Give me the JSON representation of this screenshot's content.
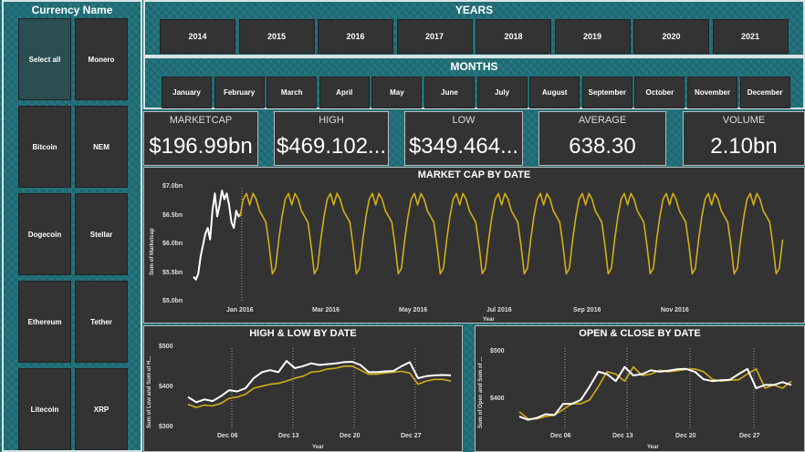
{
  "currency": {
    "title": "Currency Name",
    "items": [
      "Select all",
      "Monero",
      "Bitcoin",
      "NEM",
      "Dogecoin",
      "Stellar",
      "Ethereum",
      "Tether",
      "Litecoin",
      "XRP"
    ]
  },
  "years": {
    "title": "YEARS",
    "items": [
      "2014",
      "2015",
      "2016",
      "2017",
      "2018",
      "2019",
      "2020",
      "2021"
    ]
  },
  "months": {
    "title": "MONTHS",
    "items": [
      "January",
      "February",
      "March",
      "April",
      "May",
      "June",
      "July",
      "August",
      "September",
      "October",
      "November",
      "December"
    ]
  },
  "kpis": [
    {
      "label": "MARKETCAP",
      "value": "$196.99bn"
    },
    {
      "label": "HIGH",
      "value": "$469.102..."
    },
    {
      "label": "LOW",
      "value": "$349.464..."
    },
    {
      "label": "AVERAGE",
      "value": "638.30"
    },
    {
      "label": "VOLUME",
      "value": "2.10bn"
    }
  ],
  "colors": {
    "accent": "#d4ad17",
    "line": "#ffffff",
    "bg": "#333333",
    "teal": "#1f6f78"
  },
  "chart_data": [
    {
      "type": "line",
      "title": "MARKET CAP BY DATE",
      "xlabel": "Year",
      "ylabel": "Sum of Marketcap",
      "yticks": [
        "$7.0bn",
        "$6.5bn",
        "$6.0bn",
        "$5.5bn",
        "$5.0bn"
      ],
      "xticks": [
        "Jan 2016",
        "Mar 2016",
        "May 2016",
        "Jul 2016",
        "Sep 2016",
        "Nov 2016"
      ],
      "ylim": [
        5.0,
        7.0
      ],
      "series": [
        {
          "values": [
            5.45,
            5.4,
            5.5,
            5.8,
            6.0,
            6.2,
            6.3,
            6.1,
            6.6,
            6.9,
            6.5,
            6.7,
            6.95,
            6.8,
            6.9,
            6.7,
            6.4,
            6.3,
            6.6,
            6.5,
            6.55
          ]
        },
        {
          "values": [
            6.5,
            6.8,
            6.9,
            6.7,
            6.9,
            6.8,
            6.6,
            6.5,
            6.4,
            6.0,
            5.5,
            5.6,
            6.1
          ]
        }
      ]
    },
    {
      "type": "line",
      "title": "HIGH & LOW BY DATE",
      "xlabel": "Year",
      "ylabel": "Sum of Low and Sum of H...",
      "yticks": [
        "$500",
        "$400",
        "$300"
      ],
      "xticks": [
        "Dec 06",
        "Dec 13",
        "Dec 20",
        "Dec 27"
      ],
      "ylim": [
        300,
        500
      ],
      "series": [
        {
          "values": [
            378,
            365,
            372,
            368,
            380,
            395,
            392,
            400,
            425,
            440,
            445,
            440,
            468,
            450,
            455,
            462,
            458,
            460,
            462,
            465,
            466,
            458,
            440,
            440,
            442,
            443,
            455,
            465,
            425,
            430,
            432,
            433,
            432
          ]
        },
        {
          "values": [
            360,
            352,
            358,
            356,
            362,
            375,
            378,
            385,
            400,
            405,
            410,
            412,
            418,
            425,
            430,
            440,
            442,
            448,
            450,
            455,
            455,
            445,
            435,
            435,
            438,
            440,
            442,
            438,
            410,
            418,
            422,
            422,
            418
          ]
        }
      ]
    },
    {
      "type": "line",
      "title": "OPEN & CLOSE BY DATE",
      "xlabel": "Year",
      "ylabel": "Sum of Open and Sum of ...",
      "yticks": [
        "$500",
        "$400"
      ],
      "xticks": [
        "Dec 06",
        "Dec 13",
        "Dec 20",
        "Dec 27"
      ],
      "ylim": [
        340,
        510
      ],
      "series": [
        {
          "values": [
            365,
            358,
            362,
            370,
            368,
            392,
            392,
            400,
            428,
            460,
            455,
            440,
            470,
            452,
            455,
            463,
            460,
            462,
            465,
            466,
            460,
            444,
            440,
            442,
            443,
            455,
            466,
            425,
            432,
            432,
            438,
            432
          ]
        },
        {
          "values": [
            375,
            360,
            360,
            365,
            368,
            380,
            392,
            392,
            400,
            428,
            460,
            455,
            440,
            470,
            452,
            455,
            463,
            460,
            462,
            465,
            466,
            460,
            444,
            440,
            442,
            443,
            455,
            466,
            425,
            432,
            425,
            440
          ]
        }
      ]
    }
  ]
}
